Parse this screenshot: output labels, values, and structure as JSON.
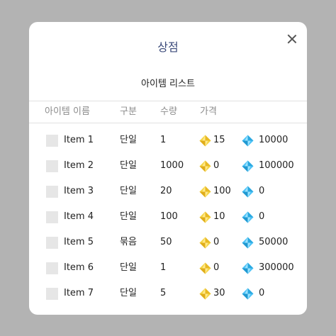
{
  "shop": {
    "title": "상점",
    "subtitle": "아이템 리스트",
    "headers": {
      "name": "아이템 이름",
      "type": "구분",
      "qty": "수량",
      "price": "가격"
    },
    "rows": [
      {
        "name": "Item 1",
        "type": "단일",
        "qty": "1",
        "gold": "15",
        "gem": "10000"
      },
      {
        "name": "Item 2",
        "type": "단일",
        "qty": "1000",
        "gold": "0",
        "gem": "100000"
      },
      {
        "name": "Item 3",
        "type": "단일",
        "qty": "20",
        "gold": "100",
        "gem": "0"
      },
      {
        "name": "Item 4",
        "type": "단일",
        "qty": "100",
        "gold": "10",
        "gem": "0"
      },
      {
        "name": "Item 5",
        "type": "묶음",
        "qty": "50",
        "gold": "0",
        "gem": "50000"
      },
      {
        "name": "Item 6",
        "type": "단일",
        "qty": "1",
        "gold": "0",
        "gem": "300000"
      },
      {
        "name": "Item 7",
        "type": "단일",
        "qty": "5",
        "gold": "30",
        "gem": "0"
      }
    ]
  },
  "icons": {
    "gold": "gold-diamond-icon",
    "gem": "blue-gem-icon",
    "close": "close-icon"
  },
  "colors": {
    "gold": "#f2c94c",
    "gem": "#56ccf2",
    "title": "#3b4a7a"
  }
}
